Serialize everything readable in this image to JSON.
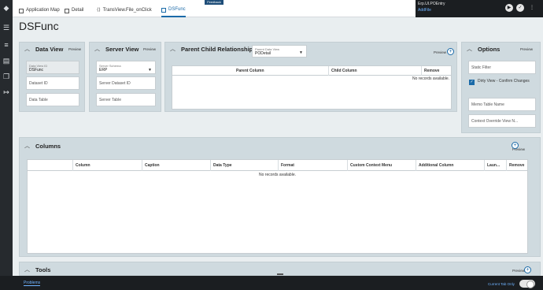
{
  "tabs": [
    {
      "label": "Application Map"
    },
    {
      "label": "Detail"
    },
    {
      "label": "TransView.File_onClick"
    },
    {
      "label": "DSFunc"
    }
  ],
  "feedback_label": "Feedback",
  "top_right": {
    "line1": "Erp.UI.POEntry",
    "line2": "AddFile"
  },
  "page_title": "DSFunc",
  "data_view": {
    "title": "Data View",
    "preview": "Preview",
    "id_label": "Data View ID",
    "id_value": "DSFunc",
    "dataset_placeholder": "Dataset ID",
    "table_placeholder": "Data Table"
  },
  "server_view": {
    "title": "Server View",
    "preview": "Preview",
    "schema_label": "Server Schema",
    "schema_value": "ERP",
    "dataset_placeholder": "Server Dataset ID",
    "table_placeholder": "Server Table"
  },
  "pcr": {
    "title": "Parent Child Relationships",
    "dv_label": "Parent Data View",
    "dv_value": "PODetail",
    "preview": "Preview",
    "columns": [
      "Parent Column",
      "Child Column",
      "Remove"
    ],
    "no_records": "No records available."
  },
  "options": {
    "title": "Options",
    "preview": "Preview",
    "static_filter": "Static Filter",
    "dirty_view": "Dirty View - Confirm Changes",
    "memo_table": "Memo Table Name",
    "context_override": "Context Override View N..."
  },
  "columns_panel": {
    "title": "Columns",
    "preview": "Preview",
    "columns": [
      "Column",
      "Caption",
      "Data Type",
      "Format",
      "Custom Context Menu",
      "Additional Column",
      "Laun...",
      "Remove"
    ],
    "no_records": "No records available."
  },
  "tools": {
    "title": "Tools",
    "preview": "Preview"
  },
  "bottom": {
    "problems": "Problems",
    "current_tab": "Current Tab Only"
  }
}
